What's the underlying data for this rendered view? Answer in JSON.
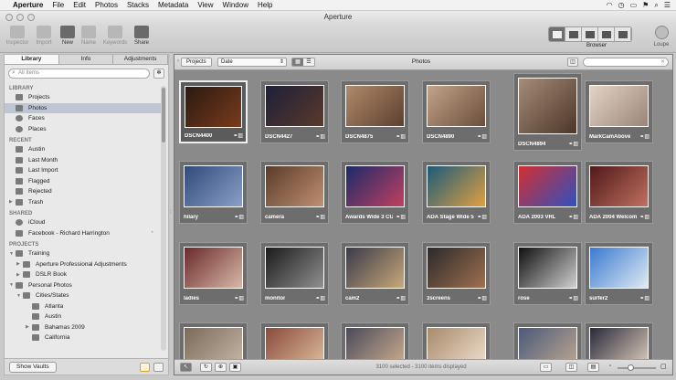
{
  "menubar": {
    "app": "Aperture",
    "items": [
      "File",
      "Edit",
      "Photos",
      "Stacks",
      "Metadata",
      "View",
      "Window",
      "Help"
    ],
    "status_icons": [
      "wifi-icon",
      "clock-icon",
      "battery-icon",
      "flag-icon",
      "spotlight-icon",
      "list-icon"
    ]
  },
  "window": {
    "title": "Aperture"
  },
  "toolbar": {
    "left_buttons": [
      {
        "label": "Inspector",
        "enabled": false
      },
      {
        "label": "Import",
        "enabled": false
      },
      {
        "label": "New",
        "enabled": true
      },
      {
        "label": "Name",
        "enabled": false
      },
      {
        "label": "Keywords",
        "enabled": false
      },
      {
        "label": "Share",
        "enabled": true
      }
    ],
    "browser_label": "Browser",
    "loupe_label": "Loupe"
  },
  "sidebar": {
    "tabs": [
      "Library",
      "Info",
      "Adjustments"
    ],
    "active_tab": "Library",
    "search_placeholder": "All Items",
    "sections": {
      "library": "LIBRARY",
      "recent": "RECENT",
      "shared": "SHARED",
      "projects": "PROJECTS"
    },
    "library_items": [
      "Projects",
      "Photos",
      "Faces",
      "Places"
    ],
    "selected_item": "Photos",
    "recent_items": [
      "Austin",
      "Last Month",
      "Last Import",
      "Flagged",
      "Rejected",
      "Trash"
    ],
    "shared_items": [
      "iCloud",
      "Facebook - Richard Harrington"
    ],
    "project_items": [
      {
        "label": "Training",
        "level": 0
      },
      {
        "label": "Aperture Professional Adjustments",
        "level": 1
      },
      {
        "label": "DSLR Book",
        "level": 1
      },
      {
        "label": "Personal Photos",
        "level": 0
      },
      {
        "label": "Cities/States",
        "level": 1
      },
      {
        "label": "Atlanta",
        "level": 2
      },
      {
        "label": "Austin",
        "level": 2
      },
      {
        "label": "Bahamas 2009",
        "level": 2
      },
      {
        "label": "California",
        "level": 2
      }
    ],
    "vaults_button": "Show Vaults"
  },
  "browser": {
    "projects_button": "Projects",
    "sort_value": "Date",
    "title": "Photos",
    "search_value": "",
    "status": "3100 selected - 3100 items displayed",
    "thumbnail_zoom": 0.25,
    "thumbnails": [
      {
        "caption": "DSCN4400",
        "selected": true
      },
      {
        "caption": "DSCN4427",
        "selected": false
      },
      {
        "caption": "DSCN4875",
        "selected": false
      },
      {
        "caption": "DSCN4890",
        "selected": false
      },
      {
        "caption": "DSCN4894",
        "selected": false
      },
      {
        "caption": "MarkCamAbove",
        "selected": false
      },
      {
        "caption": "hilary",
        "selected": false
      },
      {
        "caption": "camera",
        "selected": false
      },
      {
        "caption": "Awards Wide 3 CU",
        "selected": false
      },
      {
        "caption": "ADA Stage Wide 5",
        "selected": false
      },
      {
        "caption": "ADA 2003 VRL",
        "selected": false
      },
      {
        "caption": "ADA 2004 Welcome...",
        "selected": false
      },
      {
        "caption": "ladies",
        "selected": false
      },
      {
        "caption": "monitor",
        "selected": false
      },
      {
        "caption": "cam2",
        "selected": false
      },
      {
        "caption": "3screens",
        "selected": false
      },
      {
        "caption": "rose",
        "selected": false
      },
      {
        "caption": "surfer2",
        "selected": false
      },
      {
        "caption": "",
        "selected": false
      },
      {
        "caption": "",
        "selected": false
      },
      {
        "caption": "",
        "selected": false
      },
      {
        "caption": "",
        "selected": false
      },
      {
        "caption": "",
        "selected": false
      },
      {
        "caption": "",
        "selected": false
      }
    ]
  },
  "colors": {
    "selection": "#bfc6d3",
    "browser_bg": "#8a8a8a",
    "accent_orange": "#e0a030"
  }
}
